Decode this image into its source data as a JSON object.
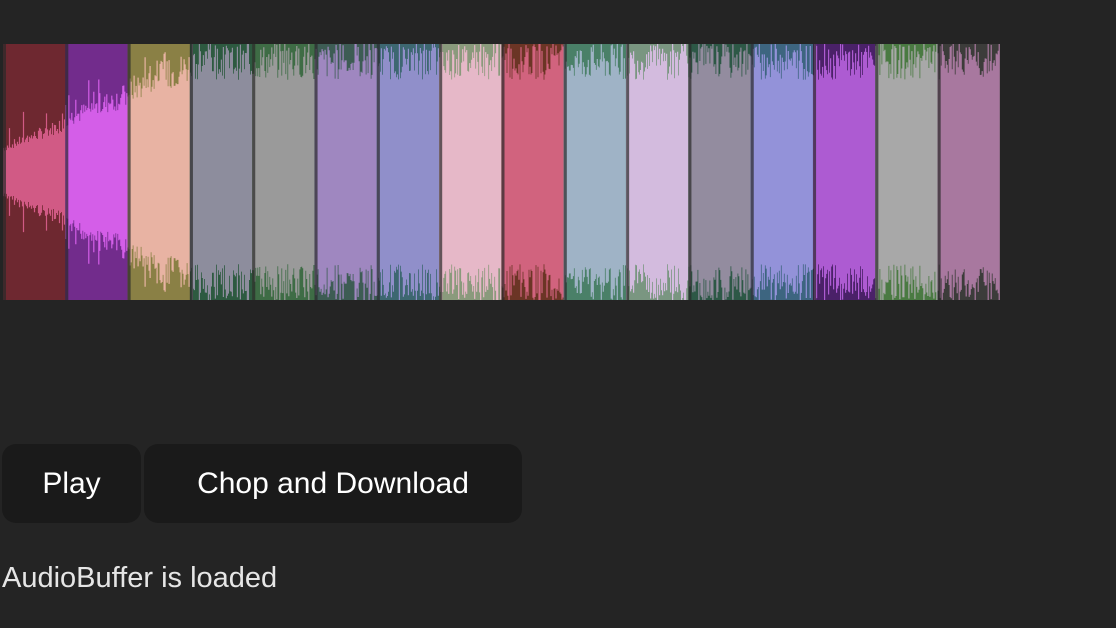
{
  "waveform": {
    "segments": [
      {
        "bg": "#6e2830",
        "wave": "#d15a85"
      },
      {
        "bg": "#722c8c",
        "wave": "#d45ee8"
      },
      {
        "bg": "#8a8045",
        "wave": "#e8b3a3"
      },
      {
        "bg": "#2d5a40",
        "wave": "#8d8d9d"
      },
      {
        "bg": "#3e6c45",
        "wave": "#9a9a9a"
      },
      {
        "bg": "#3d5c54",
        "wave": "#9f87c0"
      },
      {
        "bg": "#3d6771",
        "wave": "#908fca"
      },
      {
        "bg": "#8a9a7c",
        "wave": "#e6b8c8"
      },
      {
        "bg": "#6b3525",
        "wave": "#d1637e"
      },
      {
        "bg": "#4a8068",
        "wave": "#9fb3c6"
      },
      {
        "bg": "#7a9681",
        "wave": "#d3bbde"
      },
      {
        "bg": "#2d5846",
        "wave": "#938c9f"
      },
      {
        "bg": "#3d6580",
        "wave": "#9392d9"
      },
      {
        "bg": "#4a2168",
        "wave": "#ad5bd2"
      },
      {
        "bg": "#4a7a42",
        "wave": "#a8a8a8"
      },
      {
        "bg": "#3c3c3a",
        "wave": "#a8789f"
      }
    ]
  },
  "controls": {
    "play_label": "Play",
    "chop_label": "Chop and Download"
  },
  "status": {
    "text": "AudioBuffer is loaded"
  }
}
